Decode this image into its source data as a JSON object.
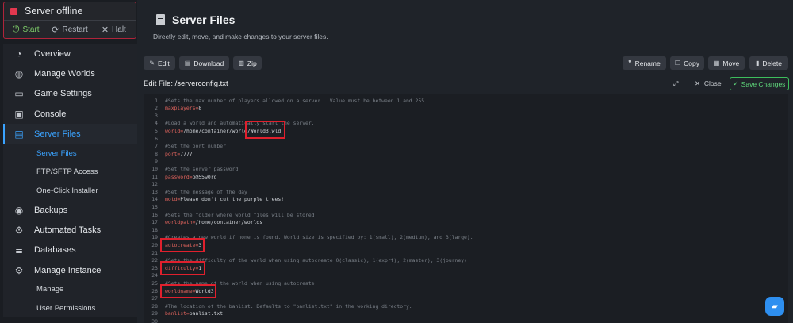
{
  "server_status": {
    "text": "Server offline",
    "start": "Start",
    "restart": "Restart",
    "halt": "Halt"
  },
  "nav": {
    "overview": "Overview",
    "manage_worlds": "Manage Worlds",
    "game_settings": "Game Settings",
    "console": "Console",
    "server_files": "Server Files",
    "sub_server_files": "Server Files",
    "sub_ftp": "FTP/SFTP Access",
    "sub_installer": "One-Click Installer",
    "backups": "Backups",
    "automated_tasks": "Automated Tasks",
    "databases": "Databases",
    "manage_instance": "Manage Instance",
    "sub_manage": "Manage",
    "sub_permissions": "User Permissions"
  },
  "page": {
    "title": "Server Files",
    "subtitle": "Directly edit, move, and make changes to your server files."
  },
  "toolbar": {
    "edit": "Edit",
    "download": "Download",
    "zip": "Zip",
    "rename": "Rename",
    "copy": "Copy",
    "move": "Move",
    "delete": "Delete"
  },
  "editbar": {
    "label": "Edit File:  /serverconfig.txt",
    "close": "Close",
    "save": "Save Changes"
  },
  "lines": [
    "#Sets the max number of players allowed on a server.  Value must be between 1 and 255",
    "maxplayers=8",
    "",
    "#Load a world and automatically start the server.",
    "world=/home/container/world/World3.wld",
    "",
    "#Set the port number",
    "port=7777",
    "",
    "#Set the server password",
    "password=p@55w0rd",
    "",
    "#Set the message of the day",
    "motd=Please don't cut the purple trees!",
    "",
    "#Sets the folder where world files will be stored",
    "worldpath=/home/container/worlds",
    "",
    "#Creates a new world if none is found. World size is specified by: 1(small), 2(medium), and 3(large).",
    "autocreate=3",
    "",
    "#Sets the difficulty of the world when using autocreate 0(classic), 1(exprt), 2(master), 3(journey)",
    "difficulty=1",
    "",
    "#Sets the name of the world when using autocreate",
    "worldname=World3",
    "",
    "#The location of the banlist. Defaults to \"banlist.txt\" in the working directory.",
    "banlist=banlist.txt",
    ""
  ],
  "colors": {
    "accent": "#3aa3ff",
    "offline": "#e2384f",
    "save": "#3dbd5c",
    "highlight": "#e0202d"
  }
}
